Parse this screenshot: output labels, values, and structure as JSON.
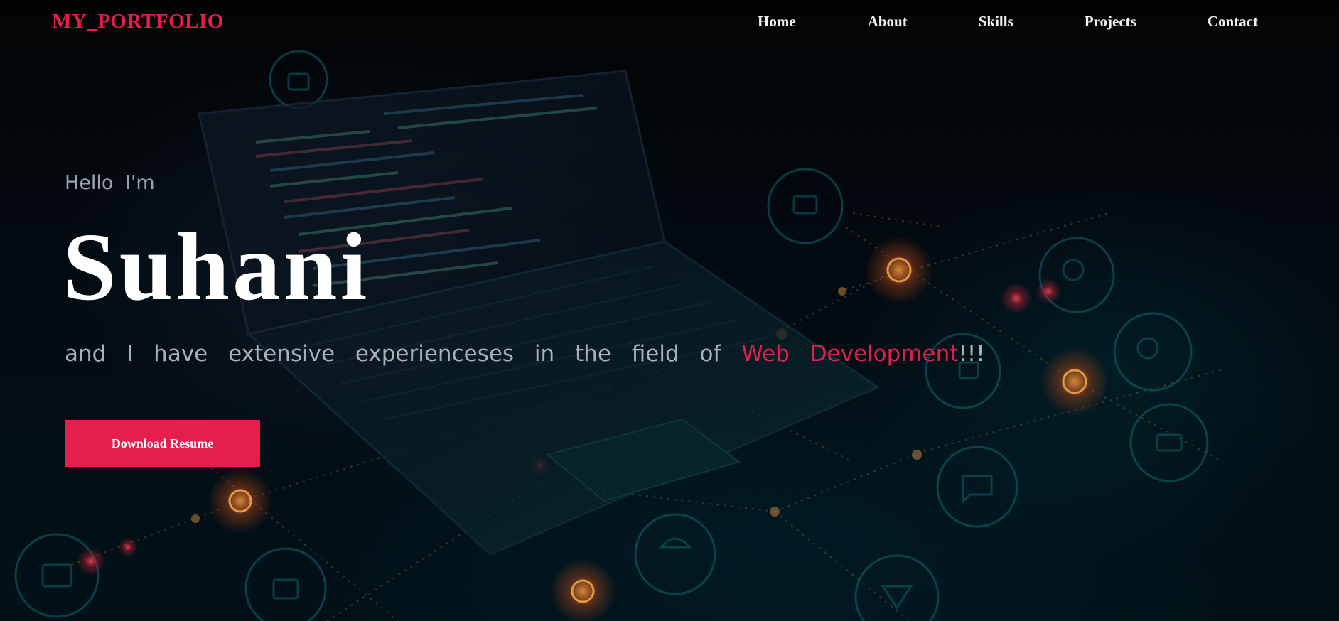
{
  "nav": {
    "logo": "MY_PORTFOLIO",
    "links": [
      {
        "label": "Home"
      },
      {
        "label": "About"
      },
      {
        "label": "Skills"
      },
      {
        "label": "Projects"
      },
      {
        "label": "Contact"
      }
    ]
  },
  "hero": {
    "greeting": "Hello I'm",
    "name": "Suhani",
    "tagline_prefix": "and I have extensive experienceses in the field of",
    "tagline_highlight": "Web Development",
    "tagline_suffix": "!!!",
    "button_label": "Download Resume"
  },
  "colors": {
    "accent": "#e61e4d",
    "background": "#020508",
    "text_primary": "#ffffff",
    "text_muted": "#a9b0b8"
  },
  "background_image": "dark circuit-board laptop illustration with glowing nodes"
}
